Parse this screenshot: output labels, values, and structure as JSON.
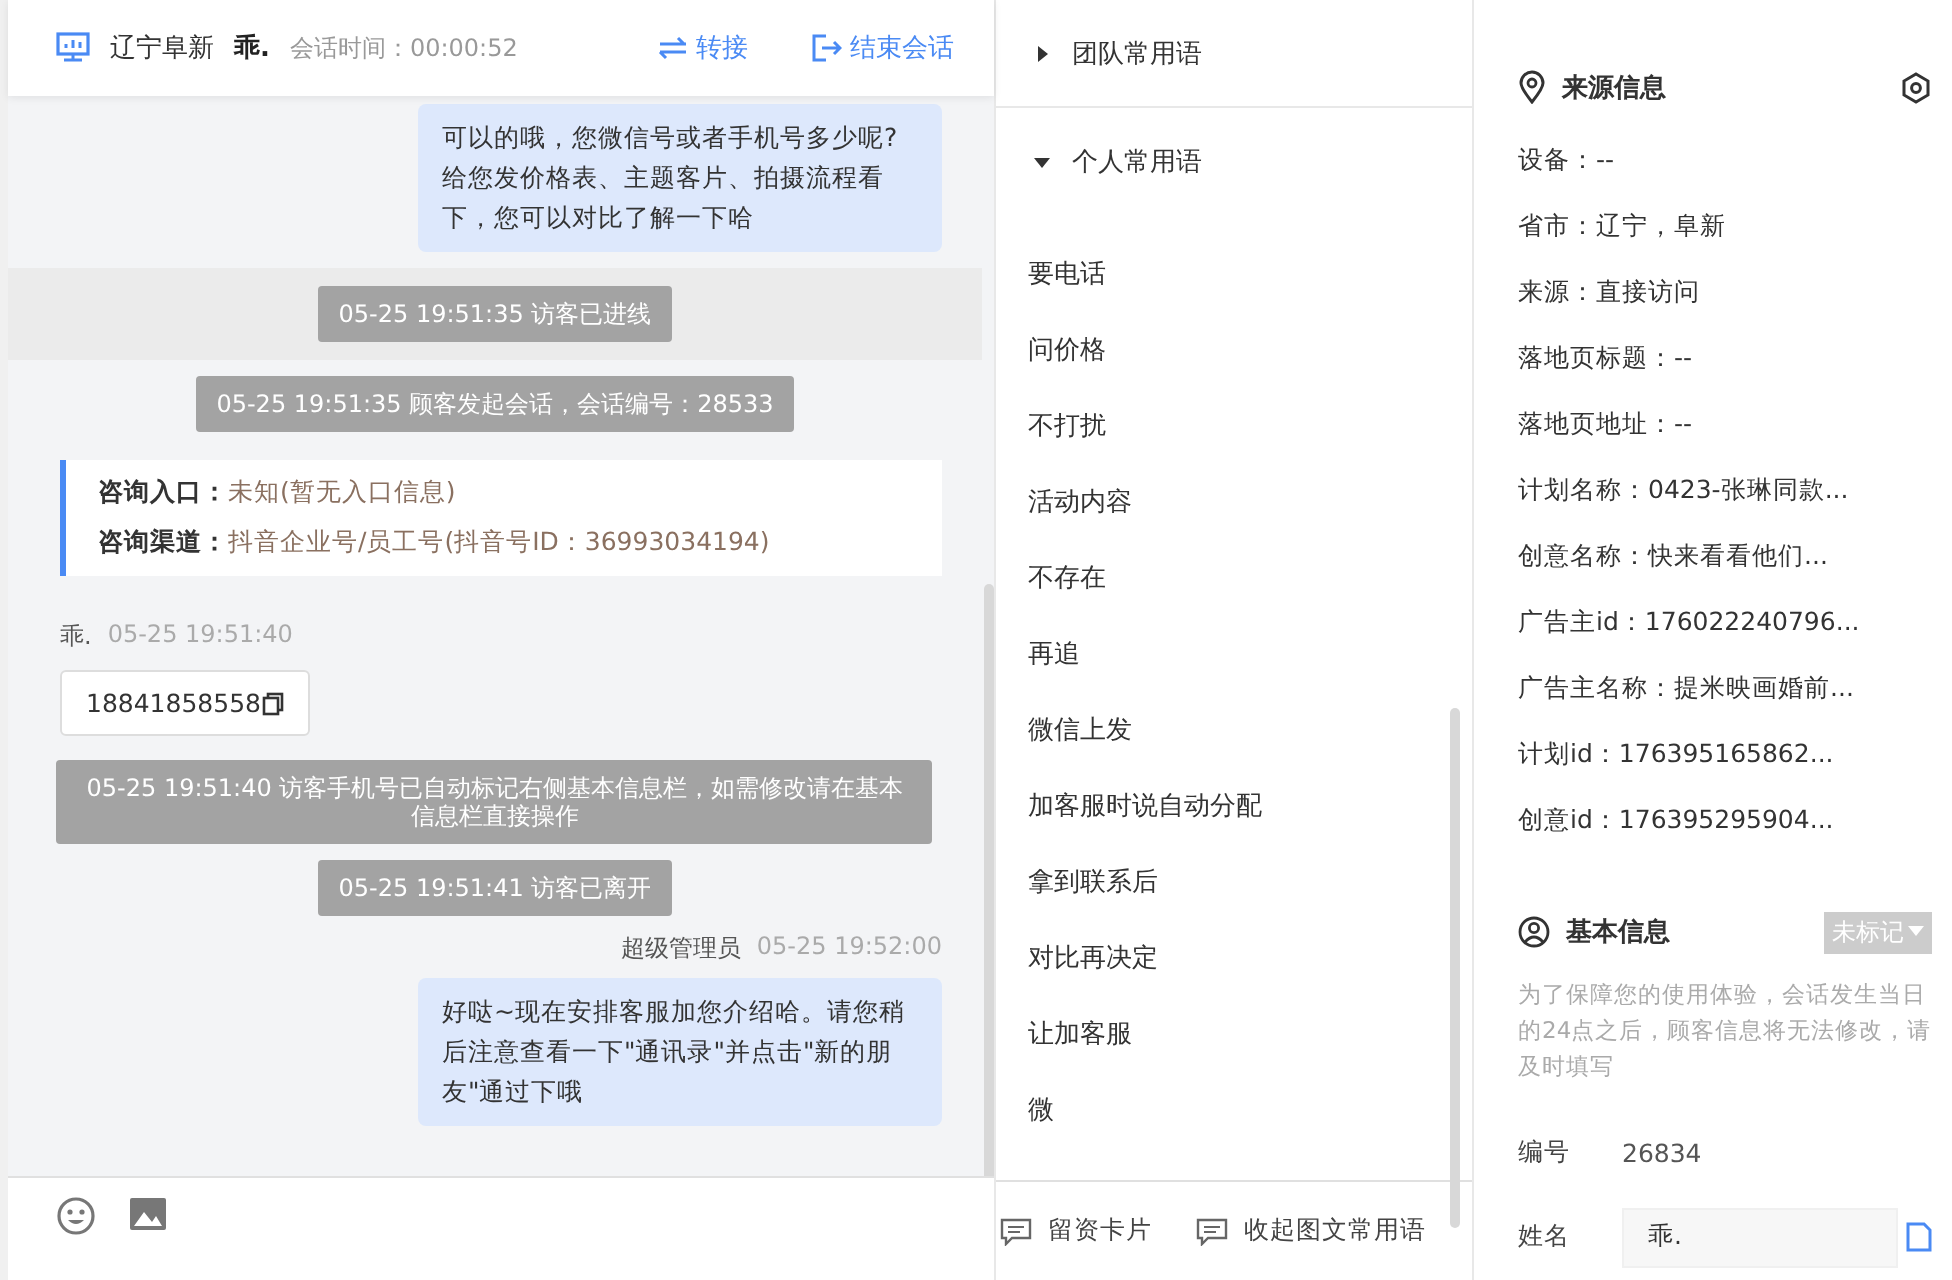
{
  "chat_header": {
    "location": "辽宁阜新",
    "visitor": "乖.",
    "duration": "会话时间：00:00:52",
    "actions": [
      {
        "kind": "transfer",
        "label": "转接"
      },
      {
        "kind": "end",
        "label": "结束会话"
      }
    ]
  },
  "messages": [
    {
      "kind": "agent",
      "text": "可以的哦，您微信号或者手机号多少呢?给您发价格表、主题客片、拍摄流程看下，您可以对比了解一下哈"
    },
    {
      "kind": "system",
      "text": "05-25 19:51:35 访客已进线",
      "highlighted": true
    },
    {
      "kind": "system",
      "text": "05-25 19:51:35 顾客发起会话，会话编号：28533",
      "highlighted": false
    },
    {
      "kind": "entry",
      "lines": [
        {
          "label": "咨询入口：",
          "value": "未知(暂无入口信息)"
        },
        {
          "label": "咨询渠道：",
          "value": "抖音企业号/员工号(抖音号ID：36993034194)"
        }
      ]
    },
    {
      "kind": "visitor",
      "sender": "乖.",
      "time": "05-25 19:51:40",
      "text": "18841858558"
    },
    {
      "kind": "system",
      "text": "05-25 19:51:40 访客手机号已自动标记右侧基本信息栏，如需修改请在基本信息栏直接操作",
      "highlighted": false
    },
    {
      "kind": "system",
      "text": "05-25 19:51:41 访客已离开",
      "highlighted": false
    },
    {
      "kind": "agent",
      "sender": "超级管理员",
      "time": "05-25 19:52:00",
      "text": "好哒~现在安排客服加您介绍哈。请您稍后注意查看一下\"通讯录\"并点击\"新的朋友\"通过下哦"
    }
  ],
  "phrases": {
    "groups": [
      {
        "title": "团队常用语",
        "expanded": false
      },
      {
        "title": "个人常用语",
        "expanded": true,
        "items": [
          "要电话",
          "问价格",
          "不打扰",
          "活动内容",
          "不存在",
          "再追",
          "微信上发",
          "加客服时说自动分配",
          "拿到联系后",
          "对比再决定",
          "让加客服",
          "微"
        ]
      }
    ],
    "footer": [
      "留资卡片",
      "收起图文常用语"
    ]
  },
  "source_info": {
    "title": "来源信息",
    "rows": [
      "设备：--",
      "省市：辽宁，阜新",
      "来源：直接访问",
      "落地页标题：--",
      "落地页地址：--",
      "计划名称：0423-张琳同款...",
      "创意名称：快来看看他们...",
      "广告主id：176022240796...",
      "广告主名称：提米映画婚前...",
      "计划id：176395165862...",
      "创意id：176395295904..."
    ]
  },
  "basic_info": {
    "title": "基本信息",
    "tag": "未标记",
    "note": "为了保障您的使用体验，会话发生当日的24点之后，顾客信息将无法修改，请及时填写",
    "fields": [
      {
        "kind": "text",
        "label": "编号",
        "value": "26834"
      },
      {
        "kind": "input",
        "label": "姓名",
        "value": "乖."
      }
    ]
  }
}
